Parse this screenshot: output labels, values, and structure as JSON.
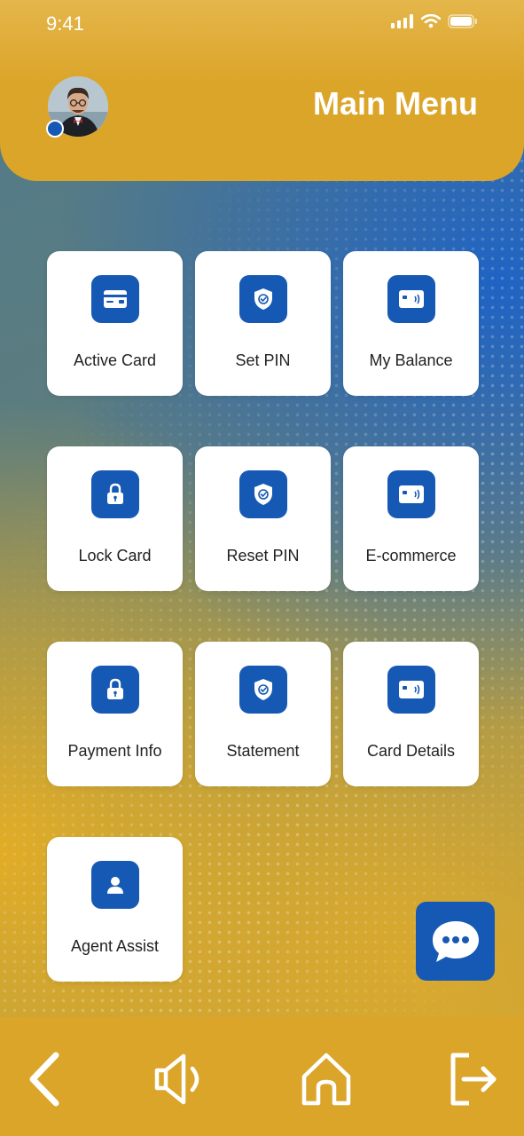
{
  "status_bar": {
    "time": "9:41"
  },
  "header": {
    "title": "Main Menu"
  },
  "menu": {
    "items": [
      {
        "label": "Active Card",
        "icon": "credit-card-icon"
      },
      {
        "label": "Set PIN",
        "icon": "shield-check-icon"
      },
      {
        "label": "My Balance",
        "icon": "contactless-card-icon"
      },
      {
        "label": "Lock Card",
        "icon": "lock-icon"
      },
      {
        "label": "Reset PIN",
        "icon": "shield-check-icon"
      },
      {
        "label": "E-commerce",
        "icon": "contactless-card-icon"
      },
      {
        "label": "Payment Info",
        "icon": "lock-icon"
      },
      {
        "label": "Statement",
        "icon": "shield-check-icon"
      },
      {
        "label": "Card Details",
        "icon": "contactless-card-icon"
      },
      {
        "label": "Agent Assist",
        "icon": "user-icon"
      }
    ]
  },
  "colors": {
    "brand_yellow": "#dba52a",
    "brand_blue": "#1659b4"
  },
  "bottom_nav": [
    "back-icon",
    "speaker-icon",
    "home-icon",
    "logout-icon"
  ]
}
